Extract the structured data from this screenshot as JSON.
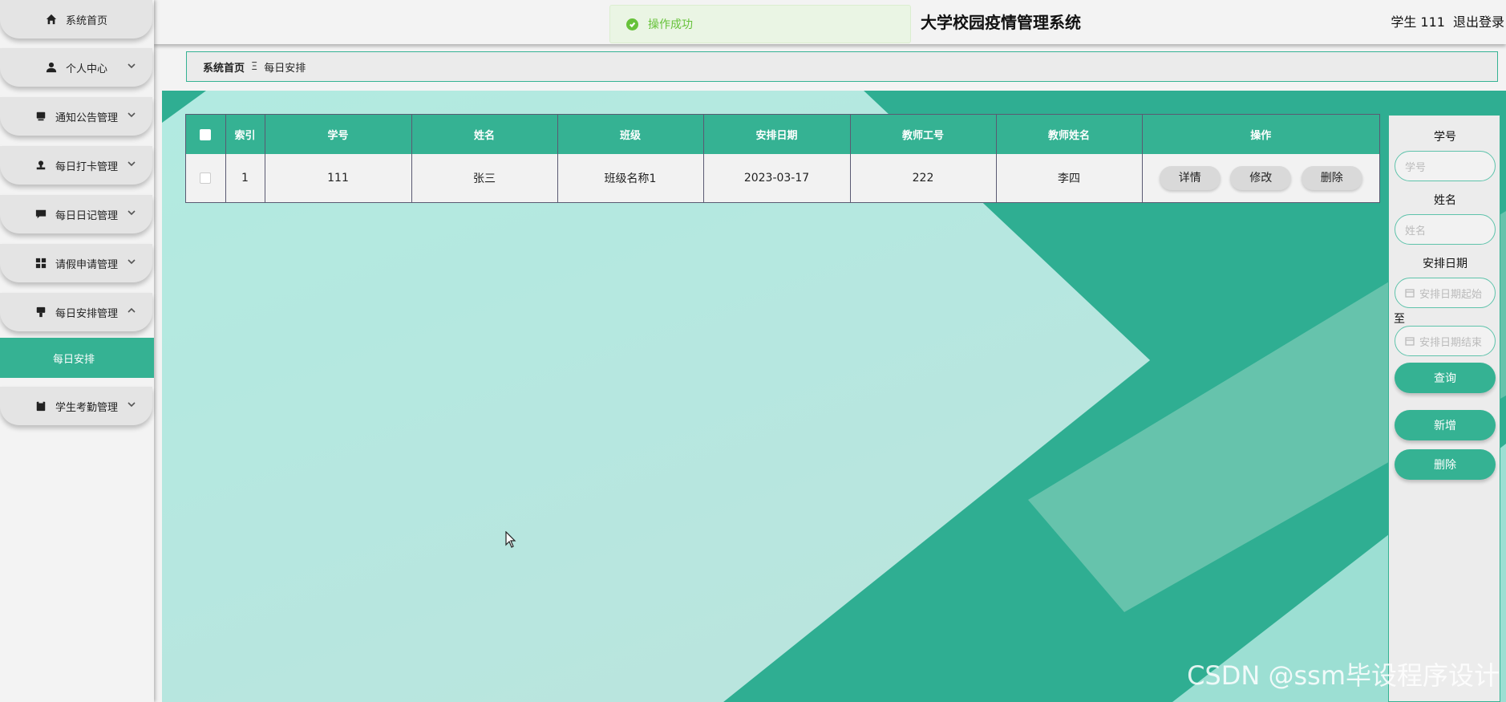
{
  "sidebar": {
    "items": [
      {
        "label": "系统首页",
        "icon": "home-icon"
      },
      {
        "label": "个人中心",
        "icon": "person-icon"
      },
      {
        "label": "通知公告管理",
        "icon": "card-icon"
      },
      {
        "label": "每日打卡管理",
        "icon": "stamp-icon"
      },
      {
        "label": "每日日记管理",
        "icon": "chat-icon"
      },
      {
        "label": "请假申请管理",
        "icon": "grid-icon"
      },
      {
        "label": "每日安排管理",
        "icon": "flag-icon"
      },
      {
        "label": "学生考勤管理",
        "icon": "clipboard-icon"
      }
    ],
    "sub_item": "每日安排"
  },
  "header": {
    "title": "大学校园疫情管理系统",
    "user": "学生 111",
    "logout": "退出登录"
  },
  "toast": {
    "message": "操作成功",
    "color": "#67c23a"
  },
  "breadcrumb": {
    "home": "系统首页",
    "separator": "Ξ",
    "current": "每日安排"
  },
  "table": {
    "headers": [
      "索引",
      "学号",
      "姓名",
      "班级",
      "安排日期",
      "教师工号",
      "教师姓名",
      "操作"
    ],
    "rows": [
      {
        "index": "1",
        "student_id": "111",
        "name": "张三",
        "class": "班级名称1",
        "date": "2023-03-17",
        "teacher_id": "222",
        "teacher_name": "李四"
      }
    ],
    "actions": {
      "detail": "详情",
      "edit": "修改",
      "delete": "删除"
    }
  },
  "search_panel": {
    "student_id_label": "学号",
    "student_id_placeholder": "学号",
    "name_label": "姓名",
    "name_placeholder": "姓名",
    "date_label": "安排日期",
    "date_start_placeholder": "安排日期起始",
    "to_label": "至",
    "date_end_placeholder": "安排日期结束",
    "search_button": "查询",
    "add_button": "新增",
    "delete_button": "删除"
  },
  "watermark": "CSDN @ssm毕设程序设计",
  "colors": {
    "accent": "#35b293",
    "background": "#f3f3f3"
  }
}
